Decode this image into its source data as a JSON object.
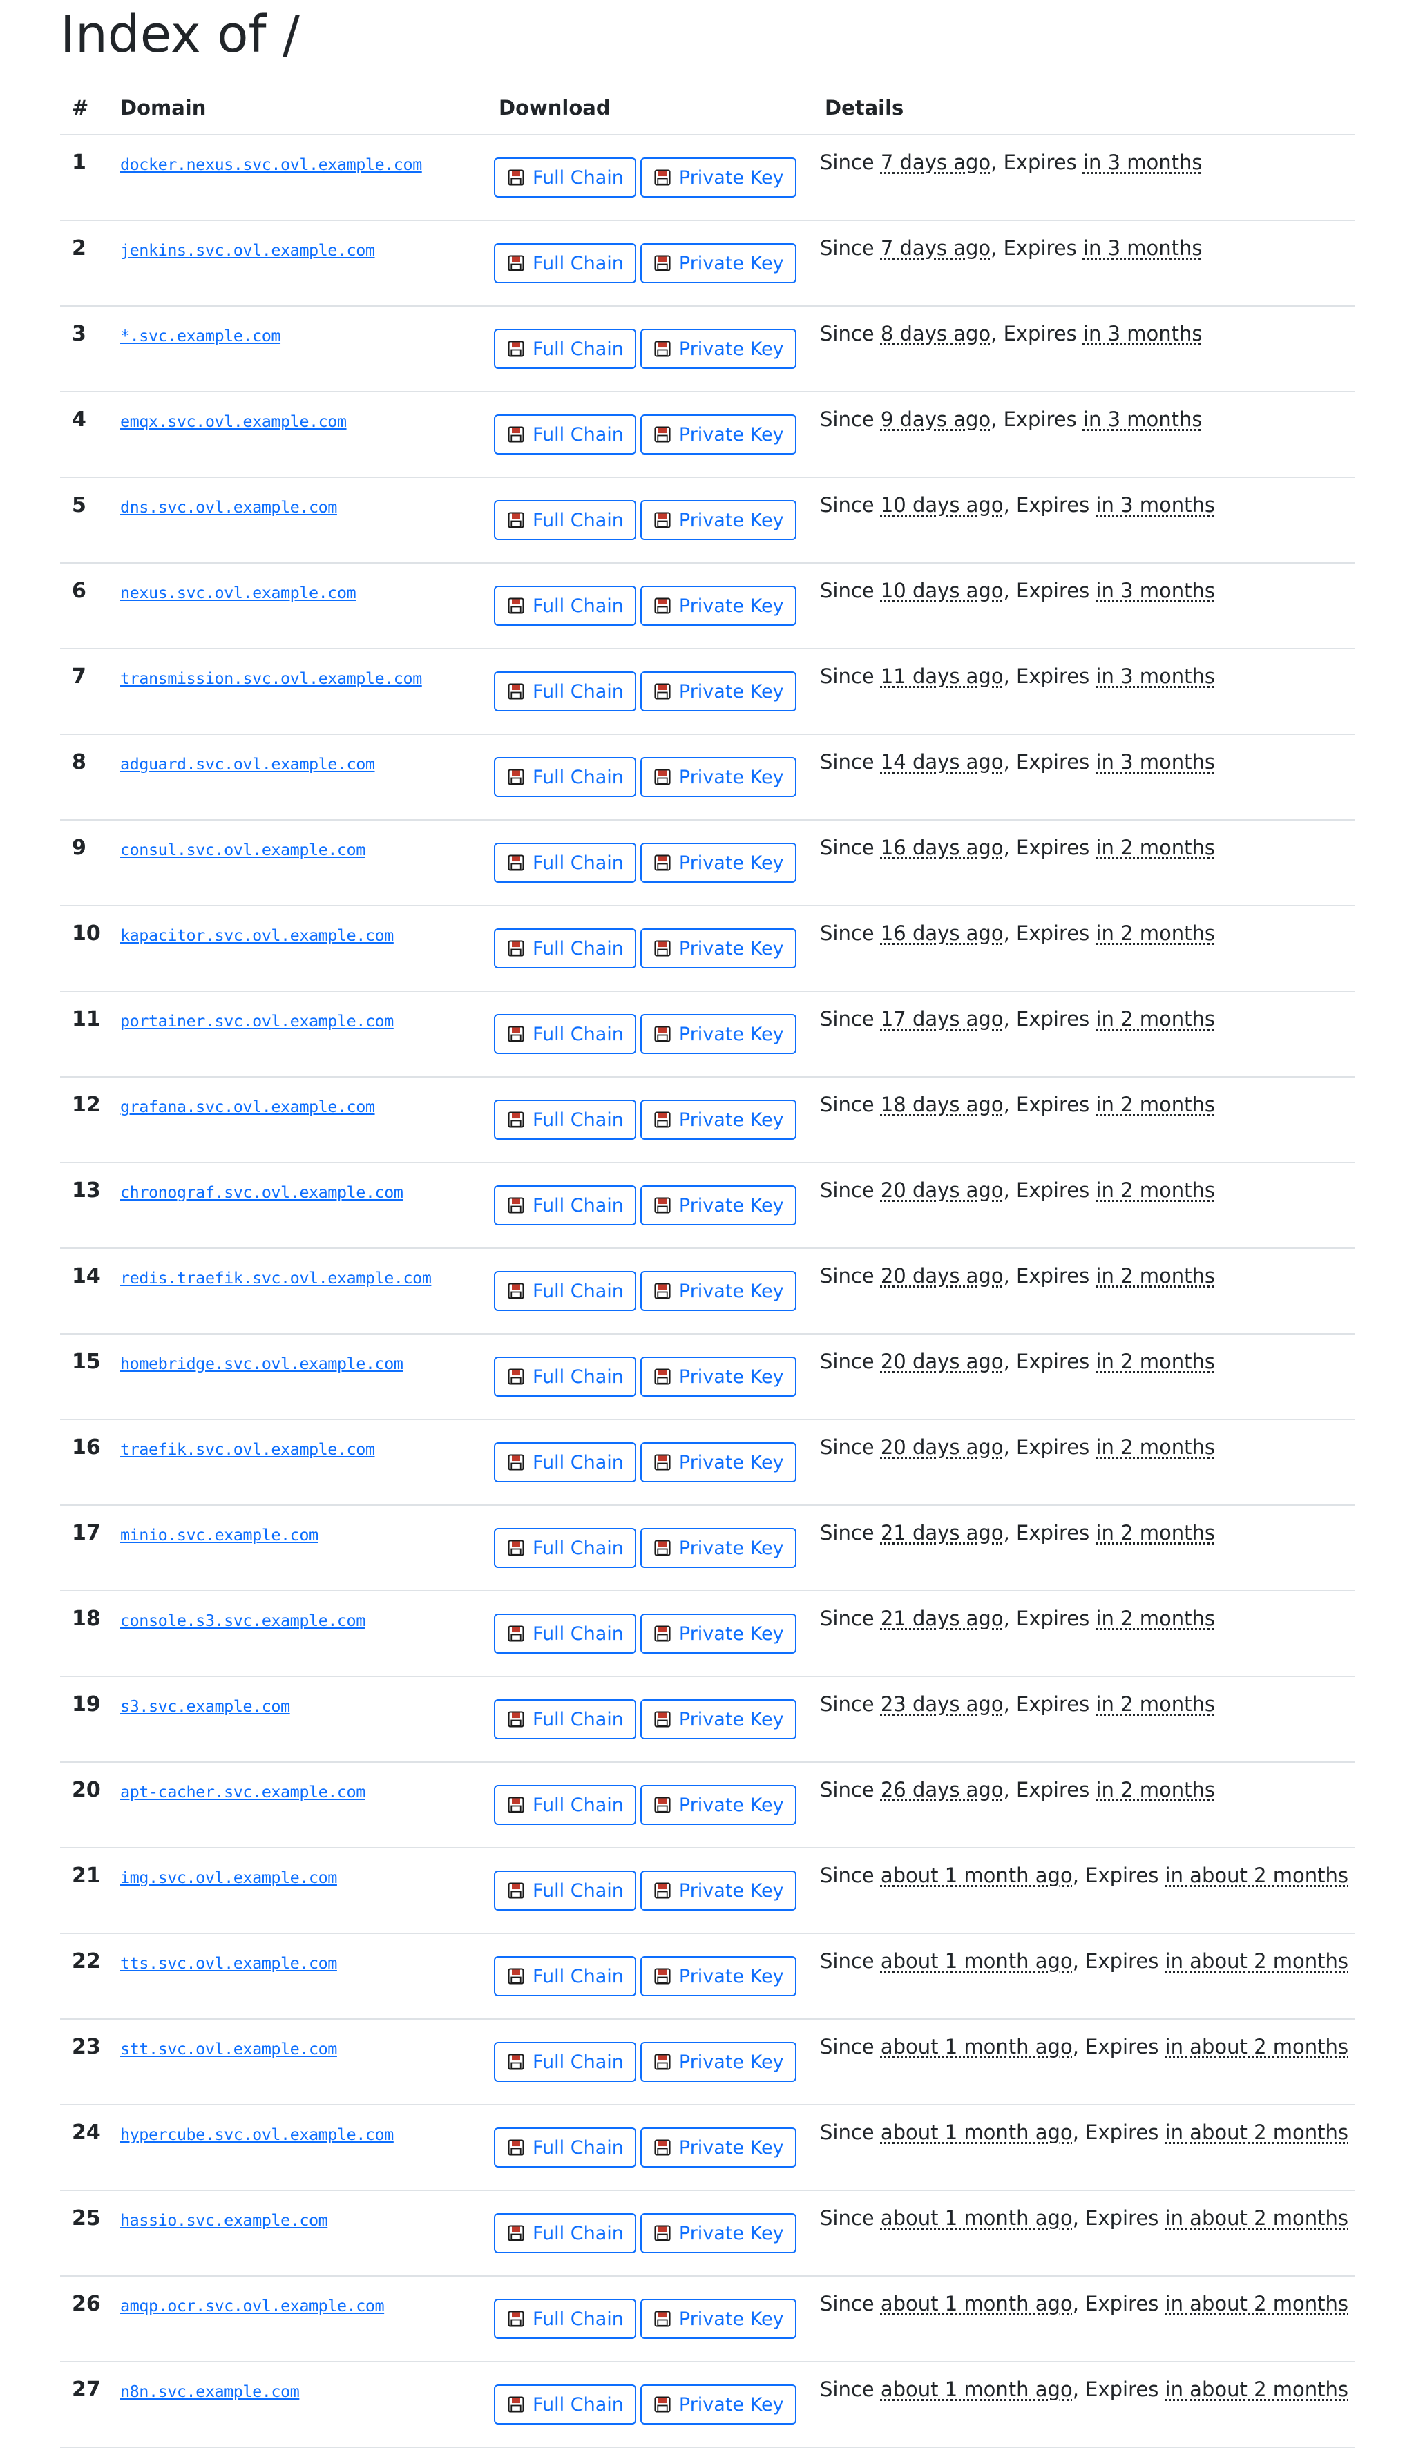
{
  "page": {
    "title": "Index of /"
  },
  "table": {
    "headers": {
      "num": "#",
      "domain": "Domain",
      "download": "Download",
      "details": "Details"
    },
    "labels": {
      "full_chain": "Full Chain",
      "private_key": "Private Key",
      "since": "Since",
      "expires": "Expires"
    },
    "rows": [
      {
        "num": "1",
        "domain": "docker.nexus.svc.ovl.example.com",
        "since": "7 days ago",
        "expires": "in 3 months"
      },
      {
        "num": "2",
        "domain": "jenkins.svc.ovl.example.com",
        "since": "7 days ago",
        "expires": "in 3 months"
      },
      {
        "num": "3",
        "domain": "*.svc.example.com",
        "since": "8 days ago",
        "expires": "in 3 months"
      },
      {
        "num": "4",
        "domain": "emqx.svc.ovl.example.com",
        "since": "9 days ago",
        "expires": "in 3 months"
      },
      {
        "num": "5",
        "domain": "dns.svc.ovl.example.com",
        "since": "10 days ago",
        "expires": "in 3 months"
      },
      {
        "num": "6",
        "domain": "nexus.svc.ovl.example.com",
        "since": "10 days ago",
        "expires": "in 3 months"
      },
      {
        "num": "7",
        "domain": "transmission.svc.ovl.example.com",
        "since": "11 days ago",
        "expires": "in 3 months"
      },
      {
        "num": "8",
        "domain": "adguard.svc.ovl.example.com",
        "since": "14 days ago",
        "expires": "in 3 months"
      },
      {
        "num": "9",
        "domain": "consul.svc.ovl.example.com",
        "since": "16 days ago",
        "expires": "in 2 months"
      },
      {
        "num": "10",
        "domain": "kapacitor.svc.ovl.example.com",
        "since": "16 days ago",
        "expires": "in 2 months"
      },
      {
        "num": "11",
        "domain": "portainer.svc.ovl.example.com",
        "since": "17 days ago",
        "expires": "in 2 months"
      },
      {
        "num": "12",
        "domain": "grafana.svc.ovl.example.com",
        "since": "18 days ago",
        "expires": "in 2 months"
      },
      {
        "num": "13",
        "domain": "chronograf.svc.ovl.example.com",
        "since": "20 days ago",
        "expires": "in 2 months"
      },
      {
        "num": "14",
        "domain": "redis.traefik.svc.ovl.example.com",
        "since": "20 days ago",
        "expires": "in 2 months"
      },
      {
        "num": "15",
        "domain": "homebridge.svc.ovl.example.com",
        "since": "20 days ago",
        "expires": "in 2 months"
      },
      {
        "num": "16",
        "domain": "traefik.svc.ovl.example.com",
        "since": "20 days ago",
        "expires": "in 2 months"
      },
      {
        "num": "17",
        "domain": "minio.svc.example.com",
        "since": "21 days ago",
        "expires": "in 2 months"
      },
      {
        "num": "18",
        "domain": "console.s3.svc.example.com",
        "since": "21 days ago",
        "expires": "in 2 months"
      },
      {
        "num": "19",
        "domain": "s3.svc.example.com",
        "since": "23 days ago",
        "expires": "in 2 months"
      },
      {
        "num": "20",
        "domain": "apt-cacher.svc.example.com",
        "since": "26 days ago",
        "expires": "in 2 months"
      },
      {
        "num": "21",
        "domain": "img.svc.ovl.example.com",
        "since": "about 1 month ago",
        "expires": "in about 2 months"
      },
      {
        "num": "22",
        "domain": "tts.svc.ovl.example.com",
        "since": "about 1 month ago",
        "expires": "in about 2 months"
      },
      {
        "num": "23",
        "domain": "stt.svc.ovl.example.com",
        "since": "about 1 month ago",
        "expires": "in about 2 months"
      },
      {
        "num": "24",
        "domain": "hypercube.svc.ovl.example.com",
        "since": "about 1 month ago",
        "expires": "in about 2 months"
      },
      {
        "num": "25",
        "domain": "hassio.svc.example.com",
        "since": "about 1 month ago",
        "expires": "in about 2 months"
      },
      {
        "num": "26",
        "domain": "amqp.ocr.svc.ovl.example.com",
        "since": "about 1 month ago",
        "expires": "in about 2 months"
      },
      {
        "num": "27",
        "domain": "n8n.svc.example.com",
        "since": "about 1 month ago",
        "expires": "in about 2 months"
      }
    ]
  },
  "icons": {
    "download_button_icon": "floppy-disk-icon"
  },
  "colors": {
    "link": "#0d6efd",
    "button_border": "#0d6efd",
    "floppy_red": "#c0392b",
    "text": "#212529",
    "divider": "#dee2e6"
  }
}
